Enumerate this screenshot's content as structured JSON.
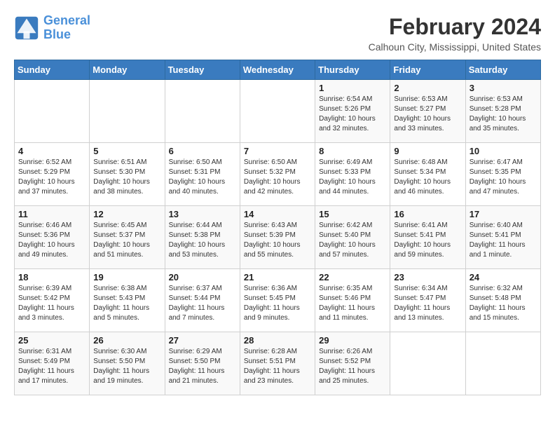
{
  "header": {
    "logo_line1": "General",
    "logo_line2": "Blue",
    "month_year": "February 2024",
    "location": "Calhoun City, Mississippi, United States"
  },
  "weekdays": [
    "Sunday",
    "Monday",
    "Tuesday",
    "Wednesday",
    "Thursday",
    "Friday",
    "Saturday"
  ],
  "weeks": [
    [
      {
        "day": "",
        "detail": ""
      },
      {
        "day": "",
        "detail": ""
      },
      {
        "day": "",
        "detail": ""
      },
      {
        "day": "",
        "detail": ""
      },
      {
        "day": "1",
        "detail": "Sunrise: 6:54 AM\nSunset: 5:26 PM\nDaylight: 10 hours\nand 32 minutes."
      },
      {
        "day": "2",
        "detail": "Sunrise: 6:53 AM\nSunset: 5:27 PM\nDaylight: 10 hours\nand 33 minutes."
      },
      {
        "day": "3",
        "detail": "Sunrise: 6:53 AM\nSunset: 5:28 PM\nDaylight: 10 hours\nand 35 minutes."
      }
    ],
    [
      {
        "day": "4",
        "detail": "Sunrise: 6:52 AM\nSunset: 5:29 PM\nDaylight: 10 hours\nand 37 minutes."
      },
      {
        "day": "5",
        "detail": "Sunrise: 6:51 AM\nSunset: 5:30 PM\nDaylight: 10 hours\nand 38 minutes."
      },
      {
        "day": "6",
        "detail": "Sunrise: 6:50 AM\nSunset: 5:31 PM\nDaylight: 10 hours\nand 40 minutes."
      },
      {
        "day": "7",
        "detail": "Sunrise: 6:50 AM\nSunset: 5:32 PM\nDaylight: 10 hours\nand 42 minutes."
      },
      {
        "day": "8",
        "detail": "Sunrise: 6:49 AM\nSunset: 5:33 PM\nDaylight: 10 hours\nand 44 minutes."
      },
      {
        "day": "9",
        "detail": "Sunrise: 6:48 AM\nSunset: 5:34 PM\nDaylight: 10 hours\nand 46 minutes."
      },
      {
        "day": "10",
        "detail": "Sunrise: 6:47 AM\nSunset: 5:35 PM\nDaylight: 10 hours\nand 47 minutes."
      }
    ],
    [
      {
        "day": "11",
        "detail": "Sunrise: 6:46 AM\nSunset: 5:36 PM\nDaylight: 10 hours\nand 49 minutes."
      },
      {
        "day": "12",
        "detail": "Sunrise: 6:45 AM\nSunset: 5:37 PM\nDaylight: 10 hours\nand 51 minutes."
      },
      {
        "day": "13",
        "detail": "Sunrise: 6:44 AM\nSunset: 5:38 PM\nDaylight: 10 hours\nand 53 minutes."
      },
      {
        "day": "14",
        "detail": "Sunrise: 6:43 AM\nSunset: 5:39 PM\nDaylight: 10 hours\nand 55 minutes."
      },
      {
        "day": "15",
        "detail": "Sunrise: 6:42 AM\nSunset: 5:40 PM\nDaylight: 10 hours\nand 57 minutes."
      },
      {
        "day": "16",
        "detail": "Sunrise: 6:41 AM\nSunset: 5:41 PM\nDaylight: 10 hours\nand 59 minutes."
      },
      {
        "day": "17",
        "detail": "Sunrise: 6:40 AM\nSunset: 5:41 PM\nDaylight: 11 hours\nand 1 minute."
      }
    ],
    [
      {
        "day": "18",
        "detail": "Sunrise: 6:39 AM\nSunset: 5:42 PM\nDaylight: 11 hours\nand 3 minutes."
      },
      {
        "day": "19",
        "detail": "Sunrise: 6:38 AM\nSunset: 5:43 PM\nDaylight: 11 hours\nand 5 minutes."
      },
      {
        "day": "20",
        "detail": "Sunrise: 6:37 AM\nSunset: 5:44 PM\nDaylight: 11 hours\nand 7 minutes."
      },
      {
        "day": "21",
        "detail": "Sunrise: 6:36 AM\nSunset: 5:45 PM\nDaylight: 11 hours\nand 9 minutes."
      },
      {
        "day": "22",
        "detail": "Sunrise: 6:35 AM\nSunset: 5:46 PM\nDaylight: 11 hours\nand 11 minutes."
      },
      {
        "day": "23",
        "detail": "Sunrise: 6:34 AM\nSunset: 5:47 PM\nDaylight: 11 hours\nand 13 minutes."
      },
      {
        "day": "24",
        "detail": "Sunrise: 6:32 AM\nSunset: 5:48 PM\nDaylight: 11 hours\nand 15 minutes."
      }
    ],
    [
      {
        "day": "25",
        "detail": "Sunrise: 6:31 AM\nSunset: 5:49 PM\nDaylight: 11 hours\nand 17 minutes."
      },
      {
        "day": "26",
        "detail": "Sunrise: 6:30 AM\nSunset: 5:50 PM\nDaylight: 11 hours\nand 19 minutes."
      },
      {
        "day": "27",
        "detail": "Sunrise: 6:29 AM\nSunset: 5:50 PM\nDaylight: 11 hours\nand 21 minutes."
      },
      {
        "day": "28",
        "detail": "Sunrise: 6:28 AM\nSunset: 5:51 PM\nDaylight: 11 hours\nand 23 minutes."
      },
      {
        "day": "29",
        "detail": "Sunrise: 6:26 AM\nSunset: 5:52 PM\nDaylight: 11 hours\nand 25 minutes."
      },
      {
        "day": "",
        "detail": ""
      },
      {
        "day": "",
        "detail": ""
      }
    ]
  ]
}
